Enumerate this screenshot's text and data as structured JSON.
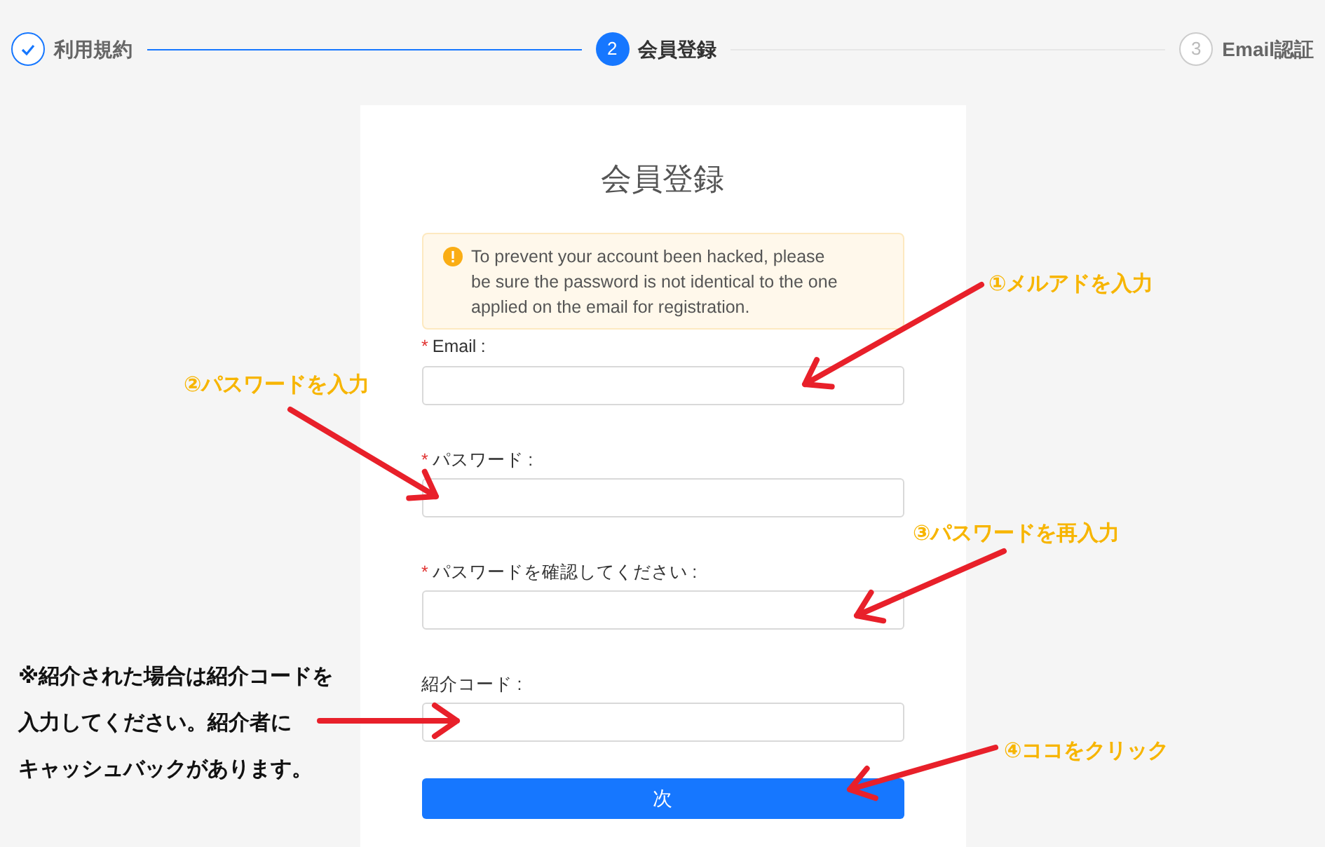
{
  "steps": [
    {
      "label": "利用規約",
      "completed": true,
      "selected": false
    },
    {
      "marker": "2",
      "label": "会員登録",
      "completed": false,
      "selected": true
    },
    {
      "marker": "3",
      "label": "Email認証",
      "completed": false,
      "selected": false
    }
  ],
  "form": {
    "title": "会員登録",
    "notice": "To prevent your account been hacked, please be sure the password is not identical to the one applied on the email for registration.",
    "fields": [
      {
        "required_mark": "*",
        "label": "Email",
        "separator": ":"
      },
      {
        "required_mark": "*",
        "label": "パスワード",
        "separator": ":"
      },
      {
        "required_mark": "*",
        "label": "パスワードを確認してください",
        "separator": ":"
      },
      {
        "label": "紹介コード",
        "separator": ":"
      }
    ],
    "submit": "次"
  },
  "annotations": [
    {
      "text": "①メルアドを入力"
    },
    {
      "text": "②パスワードを入力"
    },
    {
      "text": "③パスワードを再入力"
    },
    {
      "text": "④ココをクリック"
    }
  ],
  "note": {
    "lines": [
      "※紹介された場合は紹介コードを",
      "入力してください。紹介者に",
      "キャッシュバックがあります。"
    ]
  }
}
